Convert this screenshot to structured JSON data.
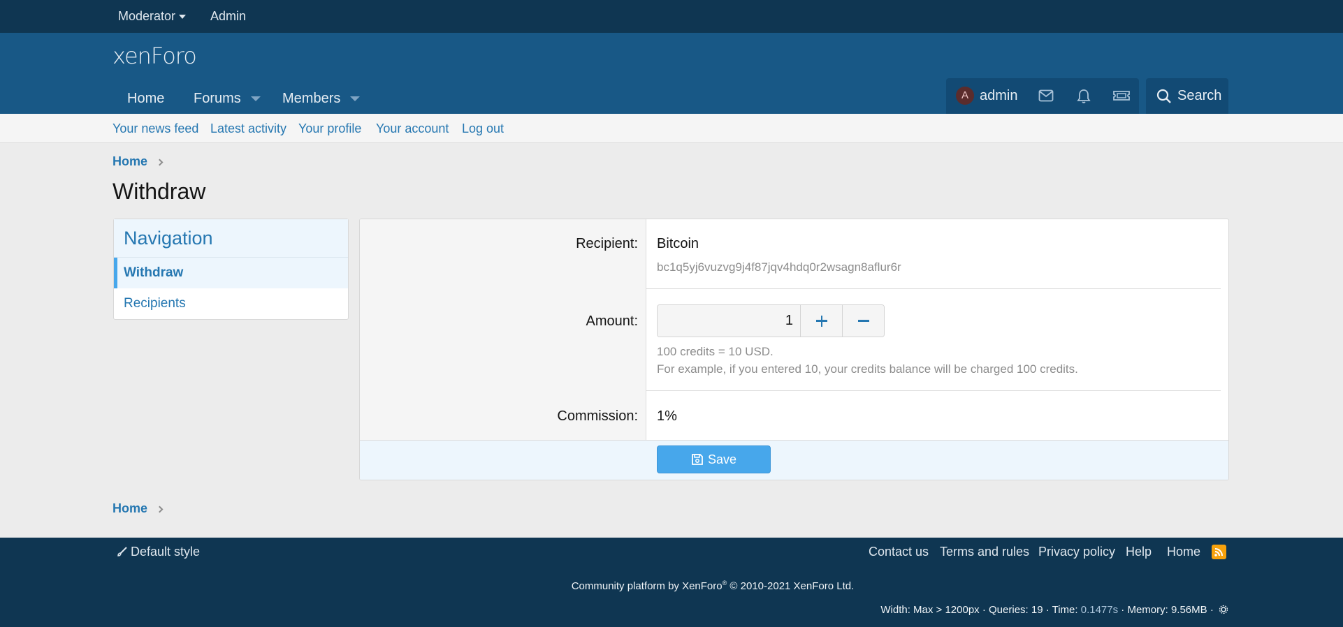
{
  "staff_bar": {
    "moderator": "Moderator",
    "admin": "Admin"
  },
  "header": {
    "logo": "xenForo",
    "tabs": [
      "Home",
      "Forums",
      "Members"
    ],
    "username": "admin",
    "avatar_letter": "A",
    "search_label": "Search"
  },
  "subnav": [
    "Your news feed",
    "Latest activity",
    "Your profile",
    "Your account",
    "Log out"
  ],
  "breadcrumb": "Home",
  "page_title": "Withdraw",
  "sidebar": {
    "heading": "Navigation",
    "items": [
      "Withdraw",
      "Recipients"
    ],
    "active_index": 0
  },
  "form": {
    "recipient_label": "Recipient:",
    "recipient_name": "Bitcoin",
    "recipient_address": "bc1q5yj6vuzvg9j4f87jqv4hdq0r2wsagn8aflur6r",
    "amount_label": "Amount:",
    "amount_value": "1",
    "amount_hint_1": "100 credits = 10 USD.",
    "amount_hint_2": "For example, if you entered 10, your credits balance will be charged 100 credits.",
    "commission_label": "Commission:",
    "commission_value": "1%",
    "save_label": "Save"
  },
  "bottom_breadcrumb": "Home",
  "footer": {
    "style_label": "Default style",
    "links": [
      "Contact us",
      "Terms and rules",
      "Privacy policy",
      "Help",
      "Home"
    ],
    "copyright_prefix": "Community platform by XenForo",
    "copyright_suffix": " © 2010-2021 XenForo Ltd.",
    "debug_prefix": "Width: Max > 1200px · Queries: 19 · Time: ",
    "debug_time": "0.1477s",
    "debug_suffix": " · Memory: 9.56MB ·"
  },
  "colors": {
    "staff_bar": "#0f3652",
    "header": "#185886",
    "link": "#2577b1",
    "button": "#47a7eb",
    "rss": "#f7a20c"
  }
}
